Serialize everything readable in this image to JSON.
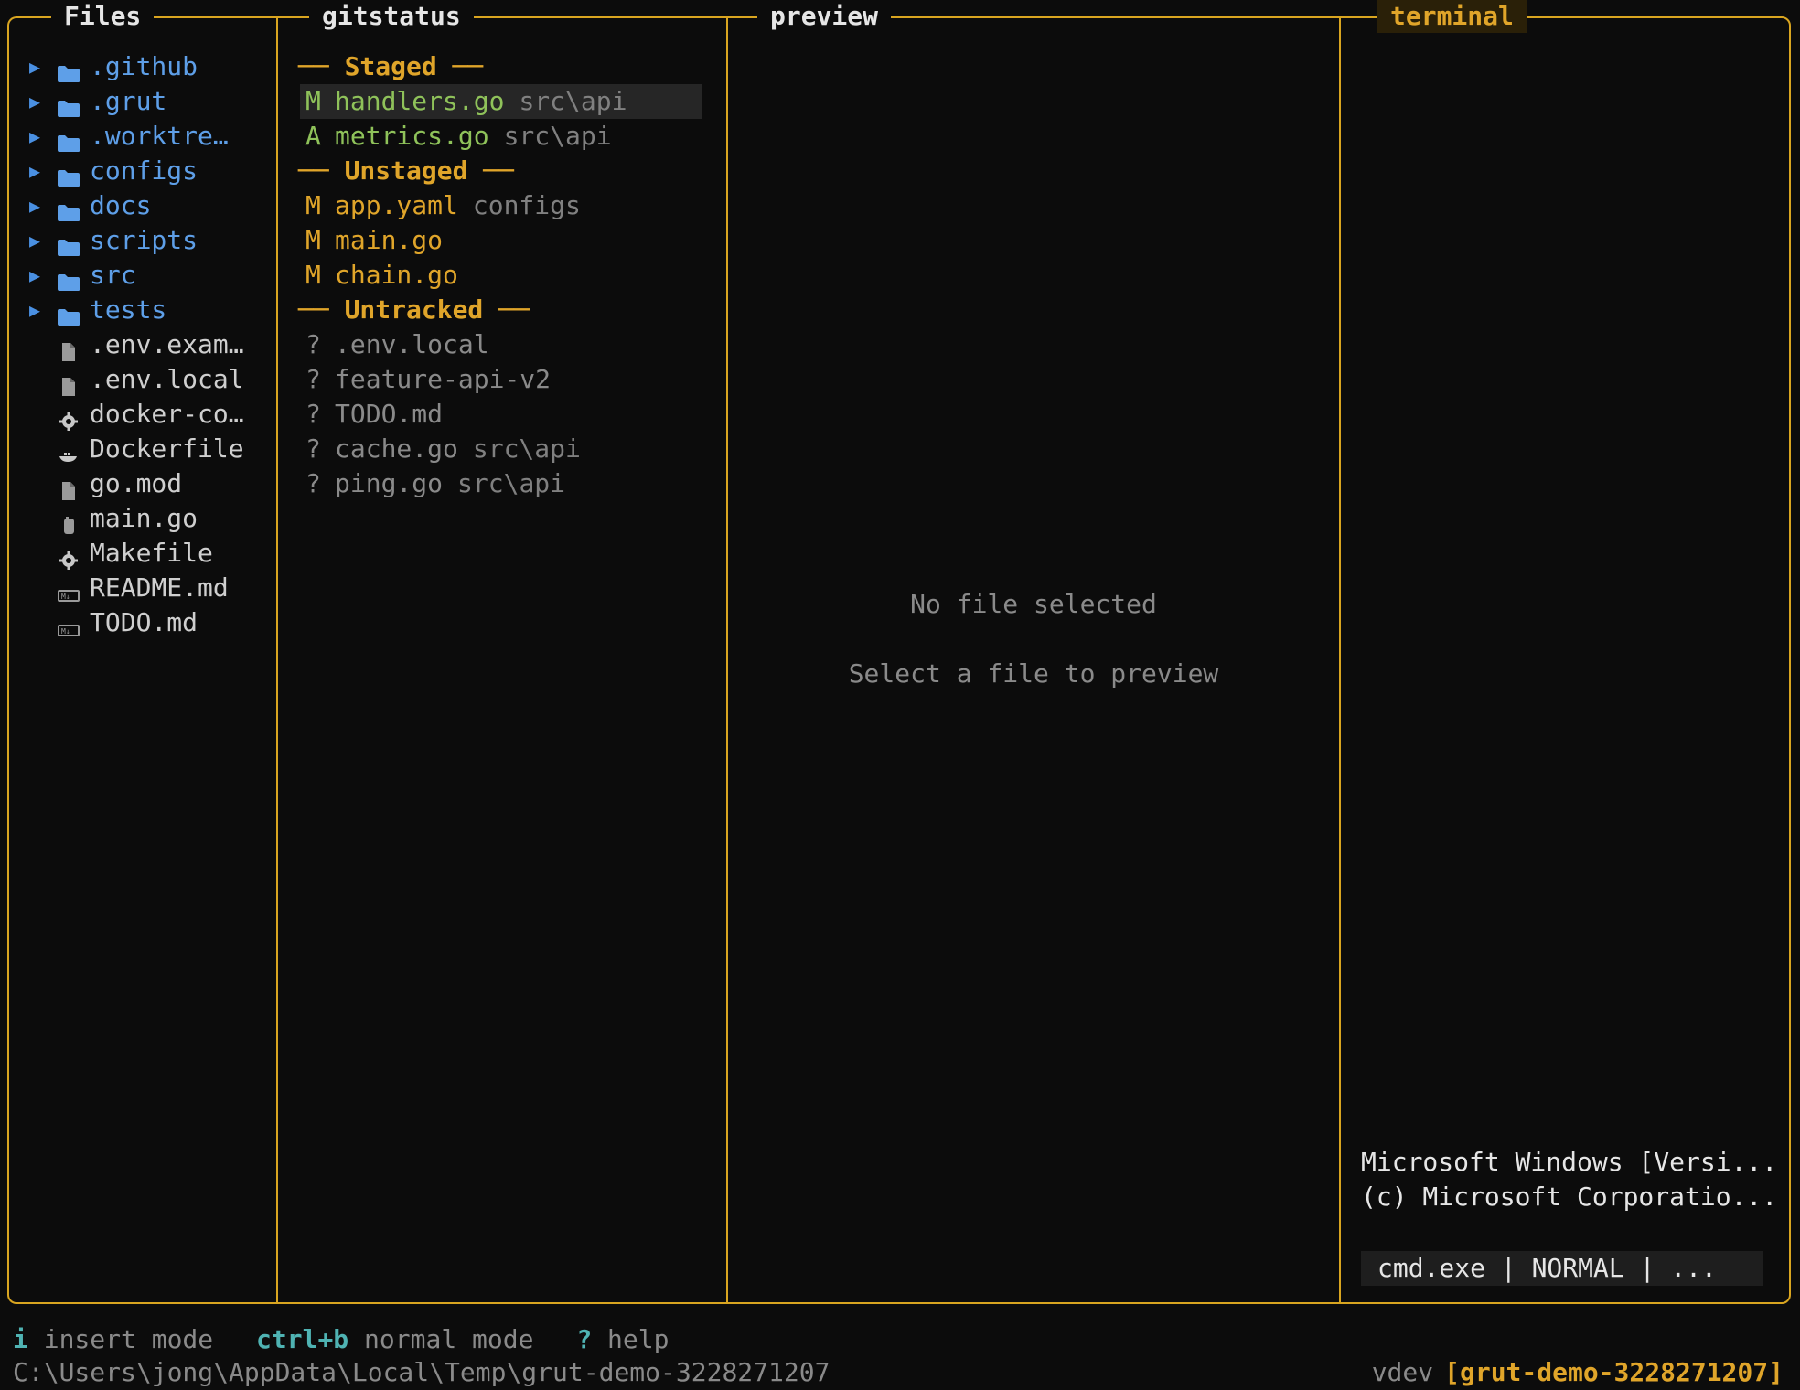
{
  "panes": {
    "files": {
      "title": "Files"
    },
    "gitstatus": {
      "title": "gitstatus"
    },
    "preview": {
      "title": "preview"
    },
    "terminal": {
      "title": "terminal"
    }
  },
  "files": {
    "items": [
      {
        "name": ".github",
        "type": "folder",
        "icon": "folder-icon"
      },
      {
        "name": ".grut",
        "type": "folder",
        "icon": "folder-icon"
      },
      {
        "name": ".worktre…",
        "type": "folder",
        "icon": "folder-icon"
      },
      {
        "name": "configs",
        "type": "folder",
        "icon": "folder-icon"
      },
      {
        "name": "docs",
        "type": "folder",
        "icon": "folder-icon"
      },
      {
        "name": "scripts",
        "type": "folder",
        "icon": "folder-icon"
      },
      {
        "name": "src",
        "type": "folder",
        "icon": "folder-icon"
      },
      {
        "name": "tests",
        "type": "folder",
        "icon": "folder-icon"
      },
      {
        "name": ".env.exam…",
        "type": "file",
        "icon": "file-icon"
      },
      {
        "name": ".env.local",
        "type": "file",
        "icon": "file-icon"
      },
      {
        "name": "docker-co…",
        "type": "file",
        "icon": "gear-icon"
      },
      {
        "name": "Dockerfile",
        "type": "file",
        "icon": "docker-icon"
      },
      {
        "name": "go.mod",
        "type": "file",
        "icon": "file-icon"
      },
      {
        "name": "main.go",
        "type": "file",
        "icon": "go-file-icon"
      },
      {
        "name": "Makefile",
        "type": "file",
        "icon": "gear-icon"
      },
      {
        "name": "README.md",
        "type": "file",
        "icon": "markdown-icon"
      },
      {
        "name": "TODO.md",
        "type": "file",
        "icon": "markdown-icon"
      }
    ]
  },
  "gitstatus": {
    "staged_header": "── Staged ──",
    "unstaged_header": "── Unstaged ──",
    "untracked_header": "── Untracked ──",
    "staged": [
      {
        "status": "M",
        "name": "handlers.go",
        "path": "src\\api"
      },
      {
        "status": "A",
        "name": "metrics.go",
        "path": "src\\api"
      }
    ],
    "unstaged": [
      {
        "status": "M",
        "name": "app.yaml",
        "path": "configs"
      },
      {
        "status": "M",
        "name": "main.go",
        "path": ""
      },
      {
        "status": "M",
        "name": "chain.go",
        "path": ""
      }
    ],
    "untracked": [
      {
        "status": "?",
        "name": ".env.local",
        "path": ""
      },
      {
        "status": "?",
        "name": "feature-api-v2",
        "path": ""
      },
      {
        "status": "?",
        "name": "TODO.md",
        "path": ""
      },
      {
        "status": "?",
        "name": "cache.go",
        "path": "src\\api"
      },
      {
        "status": "?",
        "name": "ping.go",
        "path": "src\\api"
      }
    ]
  },
  "preview": {
    "empty_title": "No file selected",
    "empty_hint": "Select a file to preview"
  },
  "terminal": {
    "lines": [
      "Microsoft Windows [Versi...",
      "(c) Microsoft Corporatio..."
    ],
    "status": "cmd.exe | NORMAL | ..."
  },
  "footer": {
    "hints": [
      {
        "key": "i",
        "desc": "insert mode"
      },
      {
        "key": "ctrl+b",
        "desc": "normal mode"
      },
      {
        "key": "?",
        "desc": "help"
      }
    ],
    "path": "C:\\Users\\jong\\AppData\\Local\\Temp\\grut-demo-3228271207",
    "version": "vdev",
    "branch": "[grut-demo-3228271207]"
  },
  "colors": {
    "border": "#d9a520",
    "folder": "#5e9fe8",
    "staged": "#8fc25a",
    "unstaged": "#e0a52a",
    "muted": "#8a8a8a",
    "key": "#4fb3b3"
  }
}
